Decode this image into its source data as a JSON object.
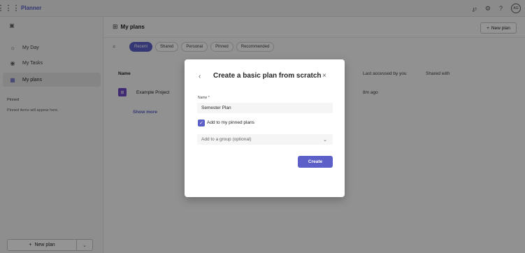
{
  "app": {
    "title": "Planner"
  },
  "topbar": {
    "avatar_initials": "AG"
  },
  "sidebar": {
    "items": [
      {
        "label": "My Day",
        "icon": "sun-icon"
      },
      {
        "label": "My Tasks",
        "icon": "person-icon"
      },
      {
        "label": "My plans",
        "icon": "grid-icon"
      }
    ],
    "pinned_title": "Pinned",
    "pinned_empty": "Pinned items will appear here.",
    "new_plan_label": "New plan"
  },
  "main": {
    "title": "My plans",
    "new_plan_label": "New plan",
    "filters": [
      "Recent",
      "Shared",
      "Personal",
      "Pinned",
      "Recommended"
    ],
    "active_filter": "Recent",
    "columns": {
      "name": "Name",
      "last_accessed": "Last accessed by you",
      "shared_with": "Shared with"
    },
    "rows": [
      {
        "name": "Example Project",
        "last_accessed": "8m ago"
      }
    ],
    "show_more": "Show more"
  },
  "dialog": {
    "title": "Create a basic plan from scratch",
    "name_label": "Name *",
    "name_value": "Semester Plan",
    "pin_label": "Add to my pinned plans",
    "pin_checked": true,
    "group_placeholder": "Add to a group (optional)",
    "create_label": "Create"
  },
  "colors": {
    "accent": "#5b5fc7",
    "plan_icon": "#6f4bc4"
  }
}
